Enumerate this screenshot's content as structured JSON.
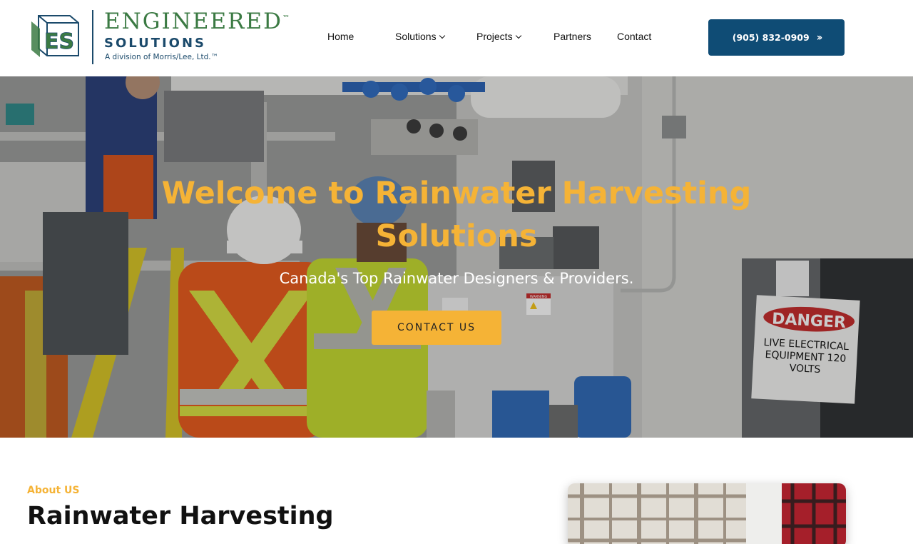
{
  "header": {
    "logo": {
      "title": "ENGINEERED",
      "tm": "™",
      "subtitle": "SOLUTIONS",
      "division": "A division of Morris/Lee, Ltd.™",
      "mark_letters": "ES"
    },
    "nav": [
      {
        "label": "Home",
        "has_dropdown": false
      },
      {
        "label": "Solutions",
        "has_dropdown": true
      },
      {
        "label": "Projects",
        "has_dropdown": true
      },
      {
        "label": "Partners",
        "has_dropdown": false
      },
      {
        "label": "Contact",
        "has_dropdown": false
      }
    ],
    "phone_button": {
      "label": "(905) 832-0909",
      "icon": "double-chevron-right-icon"
    }
  },
  "hero": {
    "title": "Welcome to Rainwater Harvesting Solutions",
    "subtitle": "Canada's Top Rainwater Designers & Providers.",
    "cta": "CONTACT US",
    "sign": {
      "header": "DANGER",
      "body": "LIVE ELECTRICAL EQUIPMENT 120 VOLTS",
      "warning_label": "WARNING"
    }
  },
  "about": {
    "eyebrow": "About US",
    "heading_light": "Rainwater",
    "heading_bold": "Harvesting"
  },
  "colors": {
    "brand_green": "#3b7a43",
    "brand_navy": "#0f4c75",
    "accent_yellow": "#f5b336"
  }
}
